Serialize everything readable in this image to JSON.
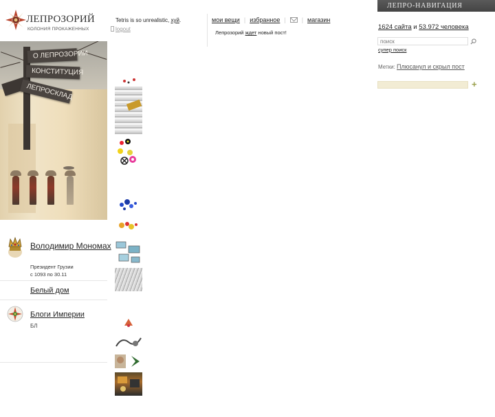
{
  "logo": {
    "name": "ЛЕПРОЗОРИЙ",
    "slogan": "КОЛОНИЯ ПРОКАЖЕННЫХ"
  },
  "poster": {
    "signs": [
      "О ЛЕПРОЗОРИИ",
      "КОНСТИТУЦИЯ",
      "ЛЕПРОСКЛАД"
    ]
  },
  "ruler": {
    "name": "Володимир Мономах",
    "title_line1": "Президент Грузии",
    "title_line2": "с 1093 по 30.11"
  },
  "whitehouse": "Белый дом",
  "blogs": {
    "title": "Блоги Империи",
    "sub": "БЛ"
  },
  "header": {
    "tagline_prefix": "Tetris is so unrealistic, ",
    "tagline_link": "хуй",
    "tagline_suffix": ".",
    "logout": "logout",
    "nav": {
      "my_stuff": "мои вещи",
      "favorites": "избранное",
      "shop": "магазин"
    },
    "notice_prefix": "Лепрозорий ",
    "notice_link": "ждет",
    "notice_suffix": " новый пост!"
  },
  "right": {
    "nav_title": "ЛЕПРО-НАВИГАЦИЯ",
    "sites": "1624 сайта",
    "and": " и ",
    "people": "53.972 человека",
    "search_placeholder": "поиск",
    "super_search": "супер поиск",
    "tags_label": "Метки: ",
    "tags_link": "Плюсанул и скрыл пост",
    "plus": "+"
  },
  "colors": {
    "nav_bg": "#4d4d4d",
    "plus": "#9aa04c",
    "input_bg": "#f2ecd4"
  }
}
